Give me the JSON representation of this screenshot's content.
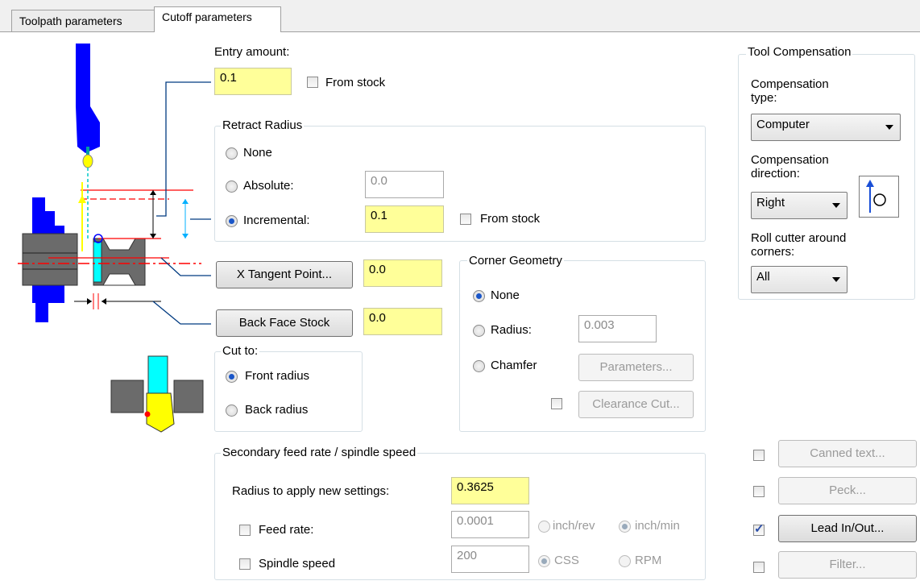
{
  "tabs": [
    "Toolpath parameters",
    "Cutoff parameters"
  ],
  "entry": {
    "label": "Entry amount:",
    "value": "0.1",
    "from_stock_label": "From stock"
  },
  "retract": {
    "title": "Retract Radius",
    "none_label": "None",
    "absolute_label": "Absolute:",
    "absolute_value": "0.0",
    "incremental_label": "Incremental:",
    "incremental_value": "0.1",
    "from_stock_label": "From stock",
    "selected": "incremental"
  },
  "x_tangent": {
    "button_label": "X Tangent Point...",
    "value": "0.0"
  },
  "back_face": {
    "button_label": "Back Face Stock",
    "value": "0.0"
  },
  "cut_to": {
    "title": "Cut to:",
    "front_label": "Front radius",
    "back_label": "Back radius",
    "selected": "front"
  },
  "corner": {
    "title": "Corner Geometry",
    "none_label": "None",
    "radius_label": "Radius:",
    "radius_value": "0.003",
    "chamfer_label": "Chamfer",
    "parameters_label": "Parameters...",
    "clearance_label": "Clearance Cut...",
    "selected": "none"
  },
  "secondary": {
    "title": "Secondary feed rate / spindle speed",
    "radius_label": "Radius to apply new settings:",
    "radius_value": "0.3625",
    "feed_label": "Feed rate:",
    "feed_value": "0.0001",
    "inch_rev_label": "inch/rev",
    "inch_min_label": "inch/min",
    "spindle_label": "Spindle speed",
    "spindle_value": "200",
    "css_label": "CSS",
    "rpm_label": "RPM"
  },
  "tool_comp": {
    "title": "Tool Compensation",
    "type_label": "Compensation type:",
    "type_value": "Computer",
    "direction_label": "Compensation direction:",
    "direction_value": "Right",
    "roll_label": "Roll cutter around corners:",
    "roll_value": "All"
  },
  "side_buttons": {
    "canned_text": "Canned text...",
    "peck": "Peck...",
    "lead_in_out": "Lead In/Out...",
    "filter": "Filter...",
    "lead_checked": true
  },
  "colors": {
    "highlight": "#ffff99",
    "tool_blue": "#0000ff",
    "cyan": "#00ffff",
    "yellow_tool": "#ffff00",
    "red_line": "#ff0000",
    "dark_line": "#003a80"
  }
}
